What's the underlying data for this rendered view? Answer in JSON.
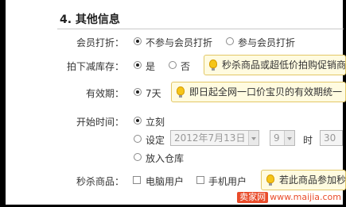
{
  "section": {
    "title": "4. 其他信息"
  },
  "member_discount": {
    "label": "会员打折：",
    "options": [
      "不参与会员打折",
      "参与会员打折"
    ],
    "selected": 0
  },
  "stock_reduce": {
    "label": "拍下减库存：",
    "options": [
      "是",
      "否"
    ],
    "selected": 0,
    "tip": "秒杀商品或超低价拍购促销商品"
  },
  "validity": {
    "label": "有效期：",
    "option": "7天",
    "tip": "即日起全网一口价宝贝的有效期统一"
  },
  "start_time": {
    "label": "开始时间：",
    "options": [
      "立刻",
      "设定",
      "放入仓库"
    ],
    "selected": 0,
    "date_value": "2012年7月13日",
    "hour_value": "9",
    "hour_unit": "时",
    "minute_value": "30"
  },
  "seckill": {
    "label": "秒杀商品：",
    "options": [
      "电脑用户",
      "手机用户"
    ],
    "tip": "若此商品参加秒"
  },
  "watermark": {
    "logo": "卖家网",
    "url": "www.maijia.com"
  }
}
